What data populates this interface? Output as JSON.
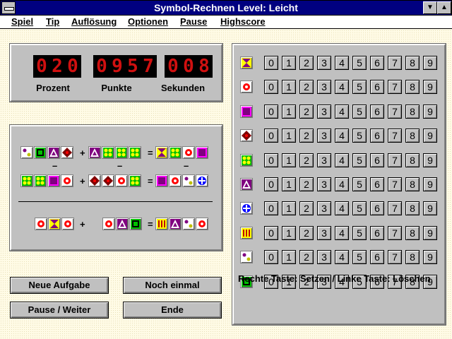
{
  "window": {
    "title": "Symbol-Rechnen    Level: Leicht"
  },
  "menu": [
    "Spiel",
    "Tip",
    "Auflösung",
    "Optionen",
    "Pause",
    "Highscore"
  ],
  "counters": [
    {
      "label": "Prozent",
      "digits": "020"
    },
    {
      "label": "Punkte",
      "digits": "0957"
    },
    {
      "label": "Sekunden",
      "digits": "008"
    }
  ],
  "colors": {
    "panel": "#c0c0c0",
    "led": "#d01010",
    "background": "#fffbe6",
    "titlebar": "#000080"
  },
  "symbols": {
    "hourglass": {
      "bg": "#ffff00",
      "fg": "#800080"
    },
    "dot-red": {
      "bg": "#ffffff",
      "fg": "#ff0000"
    },
    "square-magenta": {
      "bg": "#ff00ff",
      "fg": "#800080"
    },
    "diamond-brown": {
      "bg": "#ffffff",
      "fg": "#800000"
    },
    "four-dots": {
      "bg": "#00c000",
      "fg": "#ffff00"
    },
    "triangle-purple": {
      "bg": "#800080",
      "fg": "#ffffff"
    },
    "cross-blue": {
      "bg": "#ffffff",
      "fg": "#0000ff"
    },
    "bars-red": {
      "bg": "#ffff00",
      "fg": "#c00000"
    },
    "two-dots": {
      "bg": "#ffffff",
      "fg": "#800080"
    },
    "square-green": {
      "bg": "#00c000",
      "fg": "#000000"
    }
  },
  "puzzle": {
    "row1": {
      "a": [
        "two-dots",
        "square-green",
        "triangle-purple",
        "diamond-brown"
      ],
      "b": [
        "triangle-purple",
        "four-dots",
        "four-dots",
        "four-dots"
      ],
      "c": [
        "hourglass",
        "four-dots",
        "dot-red",
        "square-magenta"
      ]
    },
    "row2": {
      "a": [
        "four-dots",
        "four-dots",
        "square-magenta",
        "dot-red"
      ],
      "b": [
        "diamond-brown",
        "diamond-brown",
        "dot-red",
        "four-dots"
      ],
      "c": [
        "square-magenta",
        "dot-red",
        "two-dots",
        "cross-blue"
      ]
    },
    "row3": {
      "a": [
        "dot-red",
        "hourglass",
        "dot-red"
      ],
      "b": [
        "dot-red",
        "triangle-purple",
        "square-green"
      ],
      "c": [
        "bars-red",
        "triangle-purple",
        "two-dots",
        "dot-red"
      ]
    },
    "plus": "+",
    "minus": "–",
    "equals": "="
  },
  "legend_symbols": [
    "hourglass",
    "dot-red",
    "square-magenta",
    "diamond-brown",
    "four-dots",
    "triangle-purple",
    "cross-blue",
    "bars-red",
    "two-dots",
    "square-green"
  ],
  "digits": [
    "0",
    "1",
    "2",
    "3",
    "4",
    "5",
    "6",
    "7",
    "8",
    "9"
  ],
  "buttons": {
    "new": "Neue Aufgabe",
    "again": "Noch einmal",
    "pause": "Pause / Weiter",
    "end": "Ende"
  },
  "hint": "Rechte Taste: Setzen / Linke Taste: Löschen"
}
